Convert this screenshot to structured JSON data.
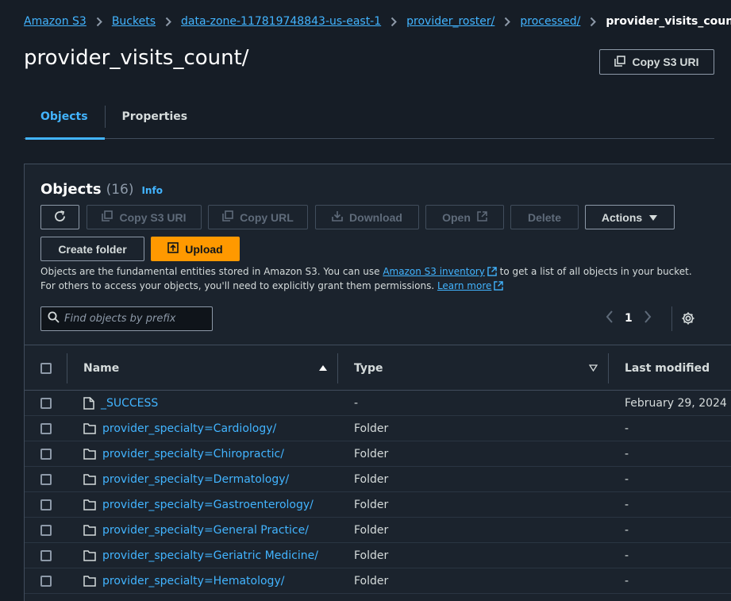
{
  "breadcrumb": {
    "items": [
      "Amazon S3",
      "Buckets",
      "data-zone-117819748843-us-east-1",
      "provider_roster/",
      "processed/"
    ],
    "current": "provider_visits_count/"
  },
  "page": {
    "title": "provider_visits_count/",
    "copy_uri_label": "Copy S3 URI"
  },
  "tabs": [
    {
      "label": "Objects",
      "active": true
    },
    {
      "label": "Properties",
      "active": false
    }
  ],
  "objects_panel": {
    "title": "Objects",
    "count": "(16)",
    "info": "Info",
    "toolbar": {
      "copy_s3_uri": "Copy S3 URI",
      "copy_url": "Copy URL",
      "download": "Download",
      "open": "Open",
      "delete": "Delete",
      "actions": "Actions",
      "create_folder": "Create folder",
      "upload": "Upload"
    },
    "description": {
      "part1": "Objects are the fundamental entities stored in Amazon S3. You can use ",
      "inventory_link": "Amazon S3 inventory",
      "part2": " to get a list of all objects in your bucket. For others to access your objects, you'll need to explicitly grant them permissions. ",
      "learn_more": "Learn more"
    },
    "search_placeholder": "Find objects by prefix",
    "page_number": "1"
  },
  "table": {
    "columns": {
      "name": "Name",
      "type": "Type",
      "last_modified": "Last modified"
    },
    "rows": [
      {
        "name": "_SUCCESS",
        "type": "-",
        "last_modified": "February 29, 2024",
        "kind": "file"
      },
      {
        "name": "provider_specialty=Cardiology/",
        "type": "Folder",
        "last_modified": "-",
        "kind": "folder"
      },
      {
        "name": "provider_specialty=Chiropractic/",
        "type": "Folder",
        "last_modified": "-",
        "kind": "folder"
      },
      {
        "name": "provider_specialty=Dermatology/",
        "type": "Folder",
        "last_modified": "-",
        "kind": "folder"
      },
      {
        "name": "provider_specialty=Gastroenterology/",
        "type": "Folder",
        "last_modified": "-",
        "kind": "folder"
      },
      {
        "name": "provider_specialty=General Practice/",
        "type": "Folder",
        "last_modified": "-",
        "kind": "folder"
      },
      {
        "name": "provider_specialty=Geriatric Medicine/",
        "type": "Folder",
        "last_modified": "-",
        "kind": "folder"
      },
      {
        "name": "provider_specialty=Hematology/",
        "type": "Folder",
        "last_modified": "-",
        "kind": "folder"
      }
    ]
  },
  "colors": {
    "background": "#161d26",
    "panel": "#1b232d",
    "link": "#42b4ff",
    "primary": "#ff9900",
    "border": "#414d5c"
  }
}
